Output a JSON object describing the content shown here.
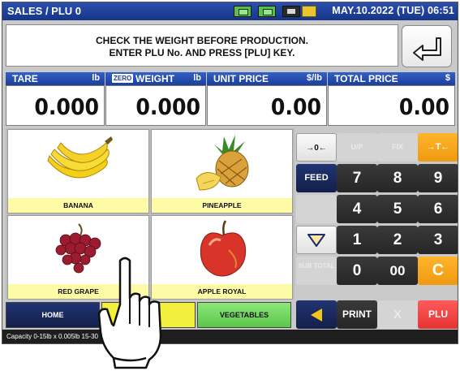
{
  "header": {
    "title": "SALES / PLU 0",
    "date": "MAY.10.2022 (TUE) 06:51",
    "colors": {
      "bar": "#1c3f9a"
    }
  },
  "message": {
    "line1": "CHECK THE WEIGHT BEFORE PRODUCTION.",
    "line2": "ENTER PLU No. AND PRESS [PLU] KEY."
  },
  "display": {
    "tare": {
      "label": "TARE",
      "unit": "lb",
      "value": "0.000"
    },
    "weight": {
      "label": "WEIGHT",
      "unit": "lb",
      "badge": "ZERO",
      "value": "0.000"
    },
    "unit_price": {
      "label": "UNIT PRICE",
      "unit": "$/lb",
      "value": "0.00"
    },
    "total_price": {
      "label": "TOTAL PRICE",
      "unit": "$",
      "value": "0.00"
    }
  },
  "products": [
    {
      "name": "BANANA",
      "icon": "banana-icon"
    },
    {
      "name": "PINEAPPLE",
      "icon": "pineapple-icon"
    },
    {
      "name": "RED GRAPE",
      "icon": "red-grape-icon"
    },
    {
      "name": "APPLE ROYAL",
      "icon": "apple-icon"
    }
  ],
  "nav": {
    "home": "HOME",
    "vegetables": "VEGETABLES"
  },
  "keypad": {
    "zero_symbol": "→0←",
    "tare_symbol": "→T←",
    "up": "U/P",
    "fix": "FIX",
    "feed": "FEED",
    "sub_total": "SUB TOTAL",
    "print": "PRINT",
    "x": "X",
    "clear": "C",
    "plu": "PLU",
    "d7": "7",
    "d8": "8",
    "d9": "9",
    "d4": "4",
    "d5": "5",
    "d6": "6",
    "d1": "1",
    "d2": "2",
    "d3": "3",
    "d0": "0",
    "d00": "00"
  },
  "status": {
    "text": "Capacity 0-15lb x 0.005lb  15-30"
  }
}
